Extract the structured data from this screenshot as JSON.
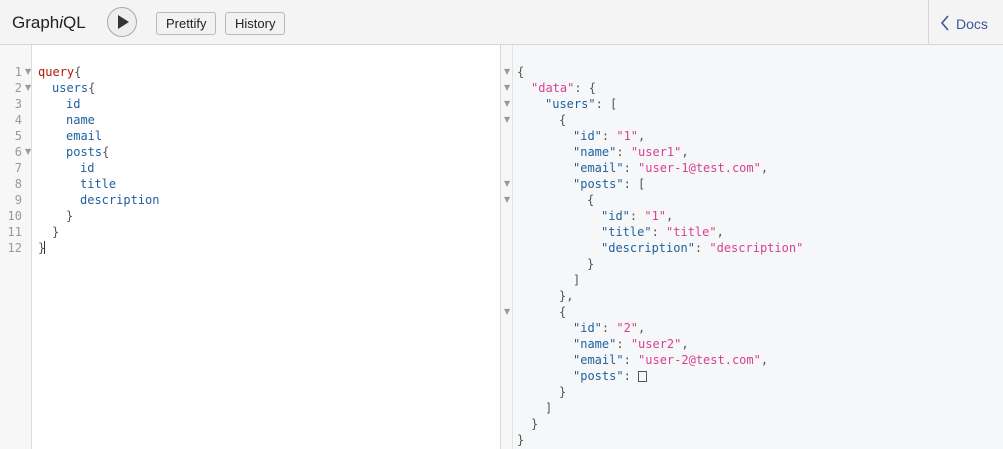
{
  "app": {
    "title_prefix": "Graph",
    "title_italic": "i",
    "title_suffix": "QL",
    "prettify_label": "Prettify",
    "history_label": "History",
    "docs_label": "Docs"
  },
  "query_editor": {
    "line_numbers": [
      "1",
      "2",
      "3",
      "4",
      "5",
      "6",
      "7",
      "8",
      "9",
      "10",
      "11",
      "12"
    ],
    "lines": {
      "l1_kw": "query",
      "l1_brace": "{",
      "l2_field": "users",
      "l2_brace": "{",
      "l3_field": "id",
      "l4_field": "name",
      "l5_field": "email",
      "l6_field": "posts",
      "l6_brace": "{",
      "l7_field": "id",
      "l8_field": "title",
      "l9_field": "description",
      "l10_brace": "}",
      "l11_brace": "}",
      "l12_brace": "}"
    }
  },
  "result": {
    "open_root": "{",
    "data_key": "\"data\"",
    "users_key": "\"users\"",
    "id_key": "\"id\"",
    "name_key": "\"name\"",
    "email_key": "\"email\"",
    "posts_key": "\"posts\"",
    "title_key": "\"title\"",
    "description_key": "\"description\"",
    "user1": {
      "id": "\"1\"",
      "name": "\"user1\"",
      "email": "\"user-1@test.com\""
    },
    "post1": {
      "id": "\"1\"",
      "title": "\"title\"",
      "description": "\"description\""
    },
    "user2": {
      "id": "\"2\"",
      "name": "\"user2\"",
      "email": "\"user-2@test.com\""
    }
  },
  "colors": {
    "keyword": "#b11a04",
    "field": "#1f61a0",
    "string": "#d64292",
    "docs_link": "#3b5998"
  },
  "icons": [
    "play-icon",
    "chevron-left-icon",
    "fold-arrow-icon"
  ]
}
